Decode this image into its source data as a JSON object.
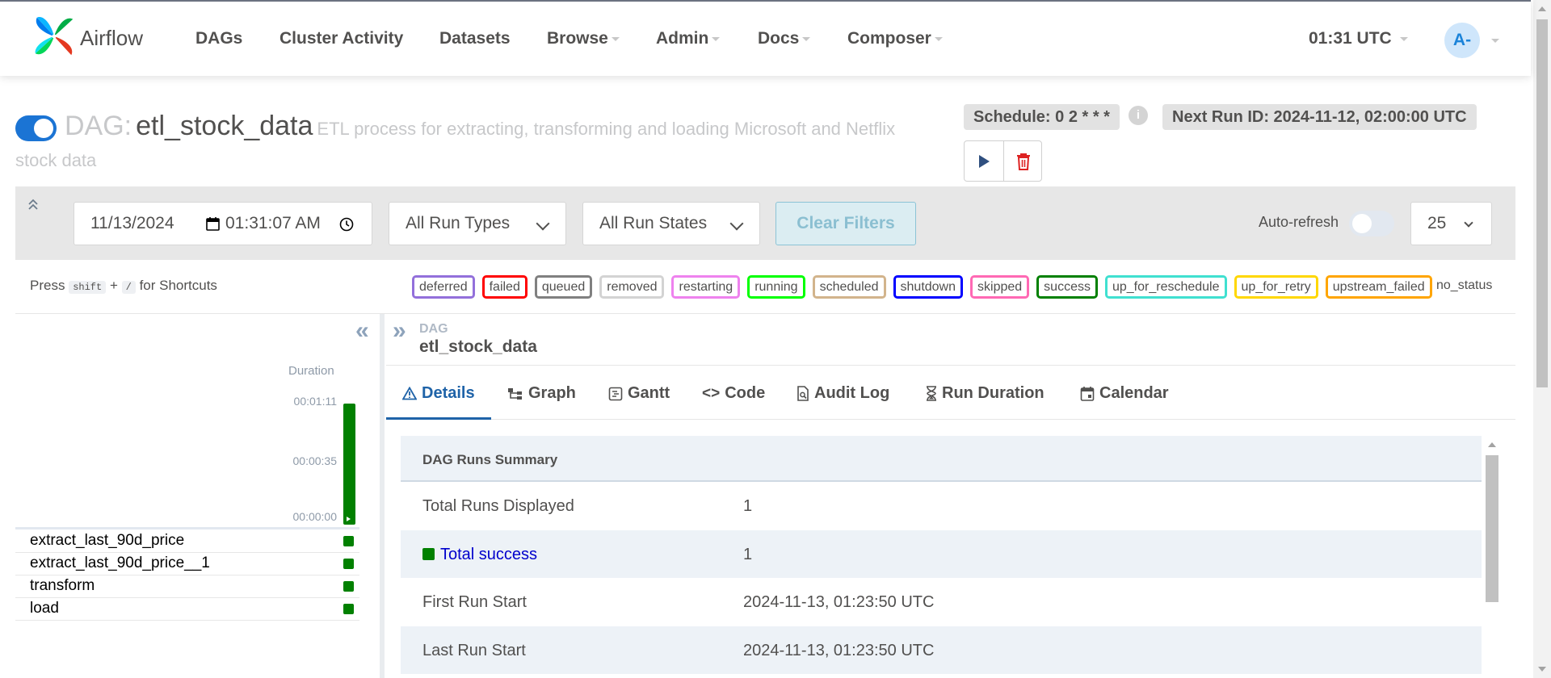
{
  "nav": {
    "brand": "Airflow",
    "items": [
      {
        "label": "DAGs"
      },
      {
        "label": "Cluster Activity"
      },
      {
        "label": "Datasets"
      },
      {
        "label": "Browse"
      },
      {
        "label": "Admin"
      },
      {
        "label": "Docs"
      },
      {
        "label": "Composer"
      }
    ],
    "time": "01:31 UTC",
    "user_initials": "A-"
  },
  "dag": {
    "prefix": "DAG:",
    "name": "etl_stock_data",
    "description_line1": "ETL process for extracting, transforming and loading Microsoft and Netflix",
    "description_line2": "stock data",
    "schedule": "Schedule: 0 2 * * *",
    "next_run": "Next Run ID: 2024-11-12, 02:00:00 UTC",
    "paused": false
  },
  "filters": {
    "date": "11/13/2024",
    "time": "01:31:07  AM",
    "run_types": "All Run Types",
    "run_states": "All Run States",
    "clear_label": "Clear Filters",
    "auto_refresh_label": "Auto-refresh",
    "auto_refresh_on": false,
    "num_runs": "25"
  },
  "shortcuts": {
    "press": "Press",
    "key1": "shift",
    "plus": "+",
    "key2": "/",
    "suffix": "for Shortcuts"
  },
  "legend": [
    {
      "label": "deferred",
      "color": "#9370db"
    },
    {
      "label": "failed",
      "color": "#ff0000"
    },
    {
      "label": "queued",
      "color": "#808080"
    },
    {
      "label": "removed",
      "color": "#d3d3d3"
    },
    {
      "label": "restarting",
      "color": "#ee82ee"
    },
    {
      "label": "running",
      "color": "#00ff00"
    },
    {
      "label": "scheduled",
      "color": "#d2b48c"
    },
    {
      "label": "shutdown",
      "color": "#0000ff"
    },
    {
      "label": "skipped",
      "color": "#ff69b4"
    },
    {
      "label": "success",
      "color": "#008000"
    },
    {
      "label": "up_for_reschedule",
      "color": "#40e0d0"
    },
    {
      "label": "up_for_retry",
      "color": "#ffd700"
    },
    {
      "label": "upstream_failed",
      "color": "#ffa500"
    }
  ],
  "no_status": "no_status",
  "grid": {
    "duration_label": "Duration",
    "ticks": [
      "00:01:11",
      "00:00:35",
      "00:00:00"
    ],
    "tasks": [
      "extract_last_90d_price",
      "extract_last_90d_price__1",
      "transform",
      "load"
    ]
  },
  "details": {
    "breadcrumb_label": "DAG",
    "breadcrumb_name": "etl_stock_data",
    "tabs": [
      "Details",
      "Graph",
      "Gantt",
      "Code",
      "Audit Log",
      "Run Duration",
      "Calendar"
    ],
    "summary_title": "DAG Runs Summary",
    "rows": [
      {
        "label": "Total Runs Displayed",
        "value": "1"
      },
      {
        "label": "Total success",
        "value": "1"
      },
      {
        "label": "First Run Start",
        "value": "2024-11-13, 01:23:50 UTC"
      },
      {
        "label": "Last Run Start",
        "value": "2024-11-13, 01:23:50 UTC"
      }
    ]
  },
  "colors": {
    "accent": "#1f63a8",
    "success": "#018000",
    "toggle_on": "#1b74d4"
  }
}
